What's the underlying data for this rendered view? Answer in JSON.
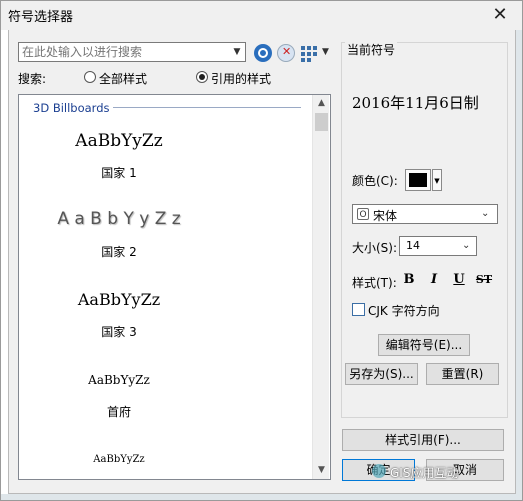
{
  "window": {
    "title": "符号选择器",
    "close_glyph": "✕"
  },
  "search": {
    "placeholder": "在此处输入以进行搜索",
    "label": "搜索:",
    "radio_all": "全部样式",
    "radio_referenced": "引用的样式",
    "selected": "radio_referenced"
  },
  "list": {
    "group_header": "3D Billboards",
    "items": [
      {
        "sample": "AaBbYyZz",
        "name": "国家 1"
      },
      {
        "sample": "A a B b Y y Z z",
        "name": "国家 2"
      },
      {
        "sample": "AaBbYyZz",
        "name": "国家 3"
      },
      {
        "sample": "AaBbYyZz",
        "name": "首府"
      },
      {
        "sample": "AaBbYyZz",
        "name": ""
      }
    ]
  },
  "current": {
    "group_label": "当前符号",
    "preview_text": "2016年11月6日制",
    "color_label": "颜色(C):",
    "color_value": "#000000",
    "font_value": "宋体",
    "size_label": "大小(S):",
    "size_value": "14",
    "style_label": "样式(T):",
    "style_buttons": {
      "bold": "B",
      "italic": "I",
      "underline": "U",
      "strike": "ST"
    },
    "cjk_label": "CJK 字符方向",
    "edit_button": "编辑符号(E)...",
    "saveas_button": "另存为(S)...",
    "reset_button": "重置(R)"
  },
  "footer": {
    "style_ref_button": "样式引用(F)...",
    "ok_button": "确定",
    "cancel_button": "取消"
  },
  "watermark": "GIS应用互动"
}
